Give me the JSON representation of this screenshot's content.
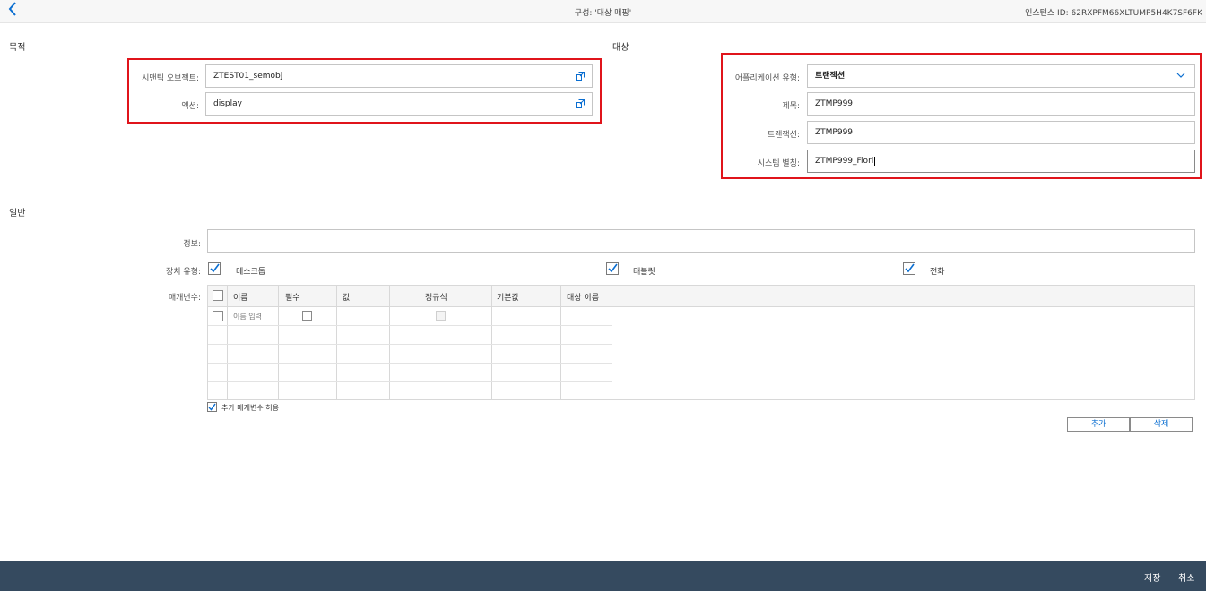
{
  "header": {
    "title": "구성: '대상 매핑'",
    "instance_id": "인스턴스 ID: 62RXPFM66XLTUMP5H4K7SF6FK"
  },
  "source": {
    "section_title": "목적",
    "semantic_object_label": "시맨틱 오브젝트:",
    "semantic_object_value": "ZTEST01_semobj",
    "action_label": "액션:",
    "action_value": "display"
  },
  "target": {
    "section_title": "대상",
    "app_type_label": "어플리케이션 유형:",
    "app_type_value": "트랜잭션",
    "title_label": "제목:",
    "title_value": "ZTMP999",
    "transaction_label": "트랜잭션:",
    "transaction_value": "ZTMP999",
    "system_alias_label": "시스템 별칭:",
    "system_alias_value": "ZTMP999_Fiori"
  },
  "general": {
    "section_title": "일반",
    "info_label": "정보:",
    "info_value": "",
    "device_type_label": "장치 유형:",
    "devices": [
      {
        "label": "데스크톱",
        "checked": true
      },
      {
        "label": "태블릿",
        "checked": true
      },
      {
        "label": "전화",
        "checked": true
      }
    ],
    "params_label": "매개변수:",
    "columns": [
      "이름",
      "필수",
      "값",
      "정규식",
      "기본값",
      "대상 이름"
    ],
    "new_row_name_placeholder": "이름 입력",
    "allow_additional_label": "추가 매개변수 허용",
    "add_button": "추가",
    "delete_button": "삭제"
  },
  "footer": {
    "save": "저장",
    "cancel": "취소"
  },
  "colors": {
    "accent": "#0a6ed1",
    "highlight_box": "#e0141b",
    "footer_bg": "#354a5f"
  },
  "icons": [
    "back-icon",
    "external-link-icon",
    "chevron-down-icon",
    "checkbox-checked-icon"
  ]
}
